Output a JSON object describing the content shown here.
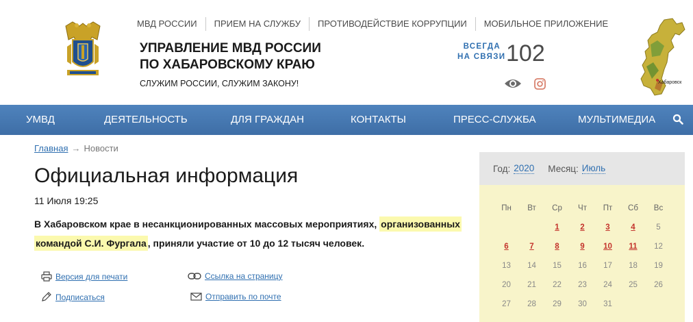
{
  "header": {
    "topnav": [
      "МВД России",
      "Прием на службу",
      "Противодействие коррупции",
      "Мобильное приложение"
    ],
    "title_line1": "УПРАВЛЕНИЕ МВД РОССИИ",
    "title_line2": "ПО ХАБАРОВСКОМУ КРАЮ",
    "slogan": "СЛУЖИМ РОССИИ, СЛУЖИМ ЗАКОНУ!",
    "hotline_line1": "ВСЕГДА",
    "hotline_line2": "НА СВЯЗИ",
    "hotline_number": "102",
    "map_label": "Хабаровск",
    "icons": {
      "emblem": "police-emblem-icon",
      "eye": "eye-icon",
      "instagram": "instagram-icon",
      "map": "region-map-icon"
    }
  },
  "mainnav": {
    "items": [
      "УМВД",
      "ДЕЯТЕЛЬНОСТЬ",
      "ДЛЯ ГРАЖДАН",
      "КОНТАКТЫ",
      "ПРЕСС-СЛУЖБА",
      "МУЛЬТИМЕДИА"
    ],
    "search_icon": "search-icon"
  },
  "breadcrumb": {
    "home": "Главная",
    "arrow": "→",
    "current": "Новости"
  },
  "article": {
    "title": "Официальная информация",
    "date": "11 Июля 19:25",
    "lead_part1": "В Хабаровском крае в несанкционированных массовых мероприятиях, ",
    "lead_highlight1": "организованных",
    "lead_highlight2": "командой С.И. Фургала",
    "lead_part2": ", приняли участие от 10 до 12 тысяч человек."
  },
  "actions": {
    "print": "Версия для печати",
    "link": "Ссылка на страницу",
    "subscribe": "Подписаться",
    "email": "Отправить по почте"
  },
  "calendar": {
    "year_label": "Год:",
    "year": "2020",
    "month_label": "Месяц:",
    "month": "Июль",
    "weekdays": [
      "Пн",
      "Вт",
      "Ср",
      "Чт",
      "Пт",
      "Сб",
      "Вс"
    ],
    "days": [
      "",
      "",
      "1",
      "2",
      "3",
      "4",
      "5",
      "6",
      "7",
      "8",
      "9",
      "10",
      "11",
      "12",
      "13",
      "14",
      "15",
      "16",
      "17",
      "18",
      "19",
      "20",
      "21",
      "22",
      "23",
      "24",
      "25",
      "26",
      "27",
      "28",
      "29",
      "30",
      "31",
      "",
      ""
    ],
    "linked_days": [
      "1",
      "2",
      "3",
      "4",
      "6",
      "7",
      "8",
      "9",
      "10",
      "11"
    ],
    "colors": {
      "link": "#c3332c",
      "accent": "#2f6fb0",
      "background": "#f8f4ca",
      "nav": "#4a7db8"
    }
  }
}
